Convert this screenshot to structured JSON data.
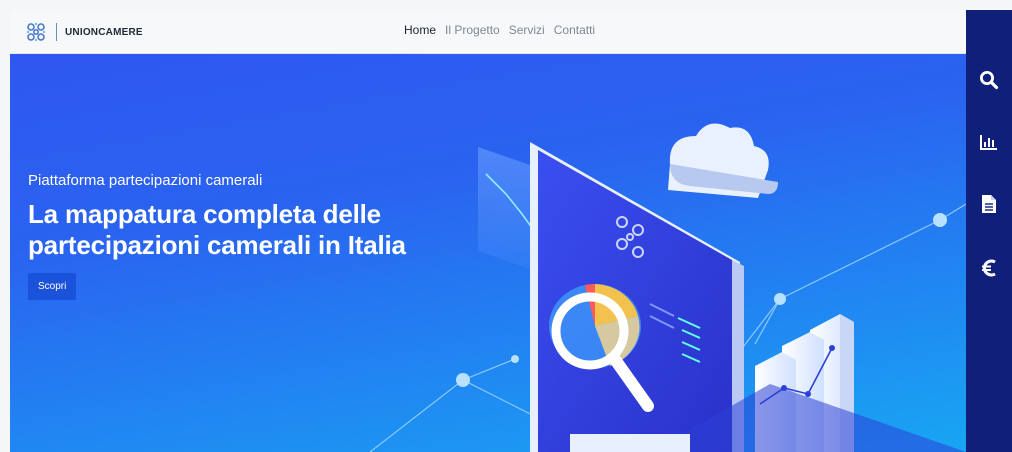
{
  "header": {
    "brand_name": "UNIONCAMERE",
    "nav": [
      {
        "label": "Home",
        "active": true
      },
      {
        "label": "Il Progetto",
        "active": false
      },
      {
        "label": "Servizi",
        "active": false
      },
      {
        "label": "Contatti",
        "active": false
      }
    ]
  },
  "hero": {
    "subtitle": "Piattaforma partecipazioni camerali",
    "title": "La mappatura completa delle partecipazioni camerali in Italia",
    "cta_label": "Scopri"
  },
  "sidebar": {
    "items": [
      {
        "icon": "search-icon"
      },
      {
        "icon": "bar-chart-icon"
      },
      {
        "icon": "document-icon"
      },
      {
        "icon": "euro-icon"
      }
    ]
  },
  "colors": {
    "hero_top": "#2f57f0",
    "hero_bottom": "#18a6f3",
    "sidebar": "#0f1f7a",
    "button": "#1a52d9"
  }
}
